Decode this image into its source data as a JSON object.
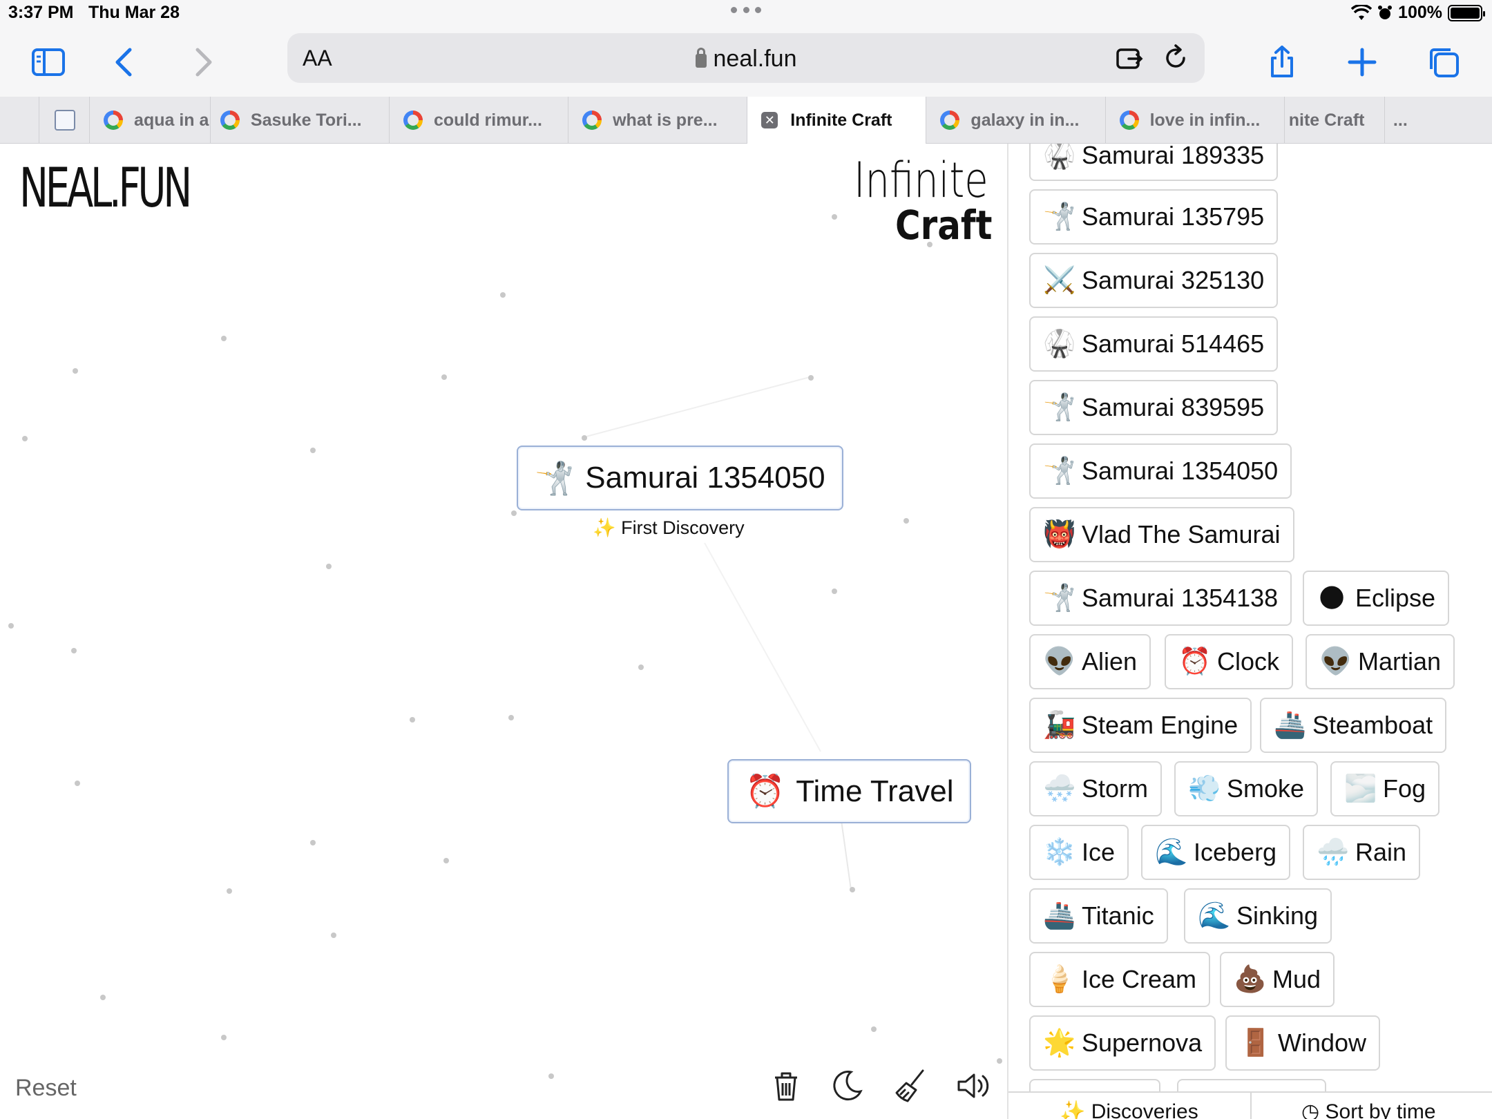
{
  "status_bar": {
    "time": "3:37 PM",
    "date": "Thu Mar 28",
    "battery": "100%"
  },
  "browser": {
    "text_size_label": "AA",
    "url": "neal.fun",
    "tabs": [
      {
        "label": "",
        "icon": "site-favicon"
      },
      {
        "label": "aqua in a",
        "icon": "google-icon"
      },
      {
        "label": "Sasuke Tori...",
        "icon": "google-icon"
      },
      {
        "label": "could rimur...",
        "icon": "google-icon"
      },
      {
        "label": "what is pre...",
        "icon": "google-icon"
      },
      {
        "label": "Infinite Craft",
        "icon": "close-icon",
        "active": true
      },
      {
        "label": "galaxy in in...",
        "icon": "google-icon"
      },
      {
        "label": "love in infin...",
        "icon": "google-icon"
      },
      {
        "label": "nite Craft",
        "icon": ""
      },
      {
        "label": "...",
        "icon": ""
      }
    ]
  },
  "game": {
    "logo": "NEAL.FUN",
    "title_line1": "Infinite",
    "title_line2": "Craft",
    "canvas_items": [
      {
        "emoji": "🤺",
        "label": "Samurai 1354050"
      },
      {
        "emoji": "⏰",
        "label": "Time Travel"
      }
    ],
    "first_discovery": "First Discovery",
    "reset_label": "Reset",
    "tools": [
      "trash-icon",
      "moon-icon",
      "broom-icon",
      "sound-icon"
    ]
  },
  "sidebar": {
    "items": [
      {
        "emoji": "🥋",
        "label": "Samurai 189335"
      },
      {
        "emoji": "🤺",
        "label": "Samurai 135795"
      },
      {
        "emoji": "⚔️",
        "label": "Samurai 325130"
      },
      {
        "emoji": "🥋",
        "label": "Samurai 514465"
      },
      {
        "emoji": "🤺",
        "label": "Samurai 839595"
      },
      {
        "emoji": "🤺",
        "label": "Samurai 1354050"
      },
      {
        "emoji": "👹",
        "label": "Vlad The Samurai"
      },
      {
        "emoji": "🤺",
        "label": "Samurai 1354138"
      },
      {
        "emoji": "🌑",
        "label": "Eclipse"
      },
      {
        "emoji": "👽",
        "label": "Alien"
      },
      {
        "emoji": "⏰",
        "label": "Clock"
      },
      {
        "emoji": "👽",
        "label": "Martian"
      },
      {
        "emoji": "🚂",
        "label": "Steam Engine"
      },
      {
        "emoji": "🚢",
        "label": "Steamboat"
      },
      {
        "emoji": "🌨️",
        "label": "Storm"
      },
      {
        "emoji": "💨",
        "label": "Smoke"
      },
      {
        "emoji": "🌫️",
        "label": "Fog"
      },
      {
        "emoji": "❄️",
        "label": "Ice"
      },
      {
        "emoji": "🌊",
        "label": "Iceberg"
      },
      {
        "emoji": "🌧️",
        "label": "Rain"
      },
      {
        "emoji": "🚢",
        "label": "Titanic"
      },
      {
        "emoji": "🌊",
        "label": "Sinking"
      },
      {
        "emoji": "🍦",
        "label": "Ice Cream"
      },
      {
        "emoji": "💩",
        "label": "Mud"
      },
      {
        "emoji": "🌟",
        "label": "Supernova"
      },
      {
        "emoji": "🚪",
        "label": "Window"
      }
    ],
    "footer": {
      "discoveries_label": "Discoveries",
      "sort_label": "Sort by time"
    }
  },
  "colors": {
    "accent": "#1a73e8",
    "item_border": "#9ab0d6",
    "chip_border": "#d6d6d6"
  }
}
